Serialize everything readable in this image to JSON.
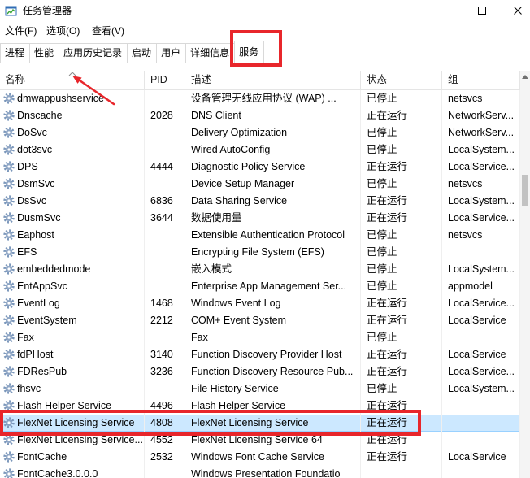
{
  "window": {
    "title": "任务管理器",
    "icon": "task-manager-icon",
    "controls": {
      "minimize": "minimize-icon",
      "maximize": "maximize-icon",
      "close": "close-icon"
    }
  },
  "menu": [
    {
      "label": "文件(F)"
    },
    {
      "label": "选项(O)"
    },
    {
      "label": "查看(V)"
    }
  ],
  "tabs": [
    {
      "label": "进程"
    },
    {
      "label": "性能"
    },
    {
      "label": "应用历史记录"
    },
    {
      "label": "启动"
    },
    {
      "label": "用户"
    },
    {
      "label": "详细信息"
    },
    {
      "label": "服务",
      "selected": true
    }
  ],
  "table": {
    "columns": [
      "名称",
      "PID",
      "描述",
      "状态",
      "组"
    ],
    "sort": {
      "column_index": 0,
      "icon": "sort-up-icon"
    },
    "row_icon": "gear-icon",
    "selected_row": 19,
    "rows": [
      {
        "name": "dmwappushservice",
        "pid": "",
        "description": "设备管理无线应用协议 (WAP) ...",
        "status": "已停止",
        "group": "netsvcs"
      },
      {
        "name": "Dnscache",
        "pid": "2028",
        "description": "DNS Client",
        "status": "正在运行",
        "group": "NetworkServ..."
      },
      {
        "name": "DoSvc",
        "pid": "",
        "description": "Delivery Optimization",
        "status": "已停止",
        "group": "NetworkServ..."
      },
      {
        "name": "dot3svc",
        "pid": "",
        "description": "Wired AutoConfig",
        "status": "已停止",
        "group": "LocalSystem..."
      },
      {
        "name": "DPS",
        "pid": "4444",
        "description": "Diagnostic Policy Service",
        "status": "正在运行",
        "group": "LocalService..."
      },
      {
        "name": "DsmSvc",
        "pid": "",
        "description": "Device Setup Manager",
        "status": "已停止",
        "group": "netsvcs"
      },
      {
        "name": "DsSvc",
        "pid": "6836",
        "description": "Data Sharing Service",
        "status": "正在运行",
        "group": "LocalSystem..."
      },
      {
        "name": "DusmSvc",
        "pid": "3644",
        "description": "数据使用量",
        "status": "正在运行",
        "group": "LocalService..."
      },
      {
        "name": "Eaphost",
        "pid": "",
        "description": "Extensible Authentication Protocol",
        "status": "已停止",
        "group": "netsvcs"
      },
      {
        "name": "EFS",
        "pid": "",
        "description": "Encrypting File System (EFS)",
        "status": "已停止",
        "group": ""
      },
      {
        "name": "embeddedmode",
        "pid": "",
        "description": "嵌入模式",
        "status": "已停止",
        "group": "LocalSystem..."
      },
      {
        "name": "EntAppSvc",
        "pid": "",
        "description": "Enterprise App Management Ser...",
        "status": "已停止",
        "group": "appmodel"
      },
      {
        "name": "EventLog",
        "pid": "1468",
        "description": "Windows Event Log",
        "status": "正在运行",
        "group": "LocalService..."
      },
      {
        "name": "EventSystem",
        "pid": "2212",
        "description": "COM+ Event System",
        "status": "正在运行",
        "group": "LocalService"
      },
      {
        "name": "Fax",
        "pid": "",
        "description": "Fax",
        "status": "已停止",
        "group": ""
      },
      {
        "name": "fdPHost",
        "pid": "3140",
        "description": "Function Discovery Provider Host",
        "status": "正在运行",
        "group": "LocalService"
      },
      {
        "name": "FDResPub",
        "pid": "3236",
        "description": "Function Discovery Resource Pub...",
        "status": "正在运行",
        "group": "LocalService..."
      },
      {
        "name": "fhsvc",
        "pid": "",
        "description": "File History Service",
        "status": "已停止",
        "group": "LocalSystem..."
      },
      {
        "name": "Flash Helper Service",
        "pid": "4496",
        "description": "Flash Helper Service",
        "status": "正在运行",
        "group": ""
      },
      {
        "name": "FlexNet Licensing Service",
        "pid": "4808",
        "description": "FlexNet Licensing Service",
        "status": "正在运行",
        "group": ""
      },
      {
        "name": "FlexNet Licensing Service...",
        "pid": "4552",
        "description": "FlexNet Licensing Service 64",
        "status": "正在运行",
        "group": ""
      },
      {
        "name": "FontCache",
        "pid": "2532",
        "description": "Windows Font Cache Service",
        "status": "正在运行",
        "group": "LocalService"
      },
      {
        "name": "FontCache3.0.0.0",
        "pid": "",
        "description": "Windows Presentation Foundatio",
        "status": "",
        "group": ""
      }
    ]
  },
  "scrollbar": {
    "position": 0.25,
    "up_icon": "chevron-up-icon"
  },
  "colors": {
    "selection_fill": "#cce8ff",
    "selection_border": "#99d1ff",
    "annotation": "#e8262b",
    "service_icon": "#7b97bb"
  }
}
